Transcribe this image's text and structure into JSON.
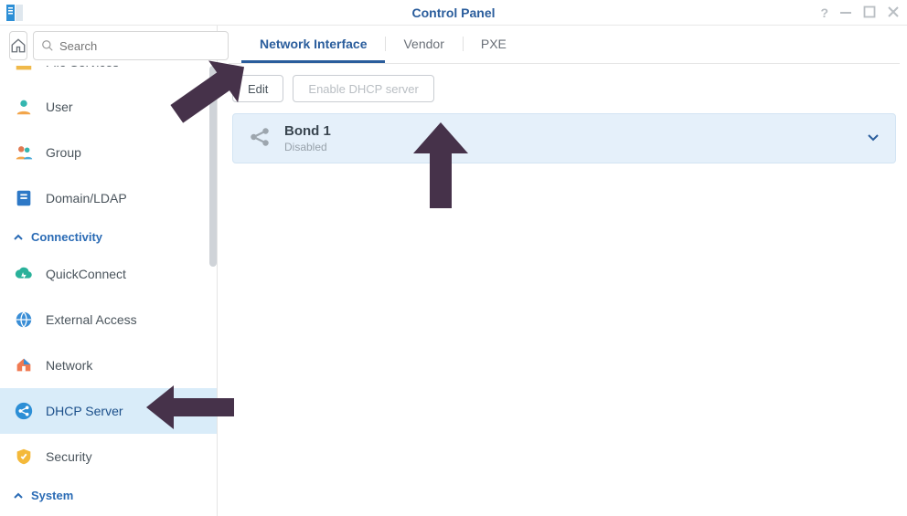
{
  "window": {
    "title": "Control Panel"
  },
  "search": {
    "placeholder": "Search"
  },
  "sidebar": {
    "cut_item": {
      "label": "File Services"
    },
    "items": [
      {
        "label": "User"
      },
      {
        "label": "Group"
      },
      {
        "label": "Domain/LDAP"
      }
    ],
    "section_connectivity": "Connectivity",
    "conn_items": [
      {
        "label": "QuickConnect"
      },
      {
        "label": "External Access"
      },
      {
        "label": "Network"
      },
      {
        "label": "DHCP Server"
      },
      {
        "label": "Security"
      }
    ],
    "section_system": "System"
  },
  "tabs": [
    {
      "label": "Network Interface"
    },
    {
      "label": "Vendor"
    },
    {
      "label": "PXE"
    }
  ],
  "toolbar": {
    "edit": "Edit",
    "enable": "Enable DHCP server"
  },
  "interface": {
    "name": "Bond 1",
    "status": "Disabled"
  }
}
